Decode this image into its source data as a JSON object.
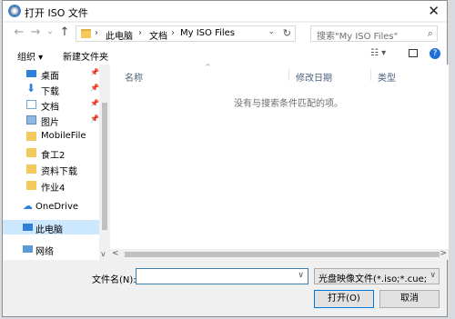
{
  "window": {
    "title": "打开 ISO 文件",
    "close_glyph": "✕"
  },
  "nav": {
    "back_glyph": "←",
    "forward_glyph": "→",
    "recent_glyph": "⌄",
    "up_glyph": "↑",
    "breadcrumbs": [
      "此电脑",
      "文档",
      "My ISO Files"
    ],
    "breadcrumb_sep": "›",
    "dropdown_glyph": "⌄",
    "refresh_glyph": "↻"
  },
  "search": {
    "placeholder": "搜索\"My ISO Files\"",
    "icon": "search-icon",
    "glyph": "⌕"
  },
  "toolbar": {
    "organize": "组织 ▾",
    "new_folder": "新建文件夹",
    "view_glyph": "☷ ▾",
    "help_glyph": "?"
  },
  "sidebar": {
    "items": [
      {
        "label": "桌面",
        "icon": "desktop-icon",
        "pinned": true
      },
      {
        "label": "下载",
        "icon": "download-icon",
        "pinned": true
      },
      {
        "label": "文档",
        "icon": "document-icon",
        "pinned": true
      },
      {
        "label": "图片",
        "icon": "picture-icon",
        "pinned": true
      },
      {
        "label": "MobileFile",
        "icon": "folder-icon",
        "pinned": false
      },
      {
        "label": "食工2",
        "icon": "folder-icon",
        "pinned": false
      },
      {
        "label": "资料下载",
        "icon": "folder-icon",
        "pinned": false
      },
      {
        "label": "作业4",
        "icon": "folder-icon",
        "pinned": false
      },
      {
        "label": "OneDrive",
        "icon": "cloud-icon",
        "pinned": false
      },
      {
        "label": "此电脑",
        "icon": "computer-icon",
        "pinned": false,
        "selected": true
      },
      {
        "label": "网络",
        "icon": "network-icon",
        "pinned": false
      }
    ],
    "pin_glyph": "📌"
  },
  "filelist": {
    "columns": [
      "名称",
      "修改日期",
      "类型"
    ],
    "sort_glyph": "^",
    "empty_text": "没有与搜索条件匹配的项。"
  },
  "scroll": {
    "left": "<",
    "right": ">",
    "down": "v"
  },
  "footer": {
    "filename_label": "文件名(N):",
    "filename_value": "",
    "filetype_value": "光盘映像文件(*.iso;*.cue;*.bin;*",
    "dd_glyph": "∨",
    "open_label": "打开(O)",
    "cancel_label": "取消"
  },
  "colors": {
    "selected": "#cce8ff",
    "accent": "#0078d7",
    "folder": "#f3c95b"
  }
}
